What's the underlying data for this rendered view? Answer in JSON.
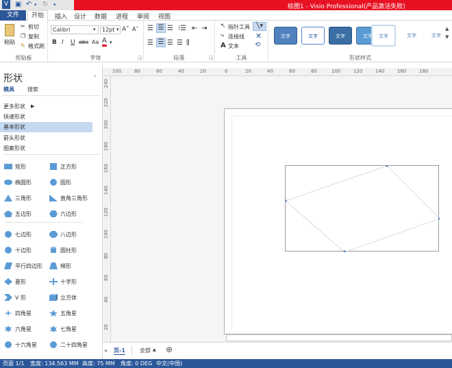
{
  "window": {
    "title": "绘图1 - Visio Professional(产品激活失败)"
  },
  "tabs": [
    "文件",
    "开始",
    "插入",
    "设计",
    "数据",
    "进程",
    "审阅",
    "视图"
  ],
  "ribbon": {
    "clipboard": {
      "paste": "粘贴",
      "cut": "剪切",
      "copy": "复制",
      "format_painter": "格式刷",
      "label": "剪贴板"
    },
    "font": {
      "name": "Calibri",
      "size": "12pt",
      "label": "字体"
    },
    "paragraph": {
      "label": "段落"
    },
    "tools": {
      "pointer": "指针工具",
      "connector": "连接线",
      "text": "文本",
      "label": "工具"
    },
    "shape_styles": {
      "label": "形状样式",
      "sample": "文字"
    }
  },
  "shapes_panel": {
    "title": "形状",
    "tabs": [
      "模具",
      "搜索"
    ],
    "categories": [
      "更多形状",
      "快速形状",
      "基本形状",
      "箭头形状",
      "图案形状"
    ],
    "items": [
      "矩形",
      "正方形",
      "椭圆形",
      "圆形",
      "三角形",
      "直角三角形",
      "五边形",
      "六边形",
      "七边形",
      "八边形",
      "十边形",
      "圆柱形",
      "平行四边形",
      "梯形",
      "菱形",
      "十字形",
      "V 形",
      "立方体",
      "四角星",
      "五角星",
      "六角星",
      "七角星",
      "十六角星",
      "二十四角星"
    ]
  },
  "ruler": {
    "h": [
      "100",
      "80",
      "60",
      "40",
      "20",
      "0",
      "20",
      "40",
      "60",
      "80",
      "100",
      "120",
      "140",
      "160",
      "180"
    ],
    "v": [
      "240",
      "220",
      "200",
      "180",
      "160",
      "140",
      "120",
      "100",
      "80",
      "60",
      "40",
      "20"
    ]
  },
  "pagebar": {
    "page": "页-1",
    "all": "全部"
  },
  "status": {
    "page": "页面 1/1",
    "width": "宽度: 134.563 MM",
    "height": "高度: 75 MM",
    "angle": "角度: 0 DEG",
    "lang": "中文(中国)"
  },
  "colors": {
    "accent": "#2b579a",
    "title_red": "#e81123",
    "shape_blue": "#5b9bd5"
  }
}
